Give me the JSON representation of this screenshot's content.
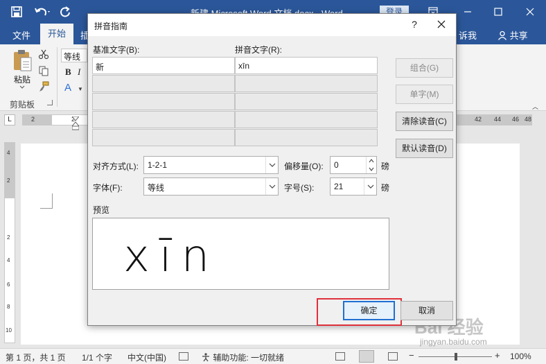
{
  "window": {
    "title": "新建 Microsoft Word 文档.docx  -  Word",
    "login_label": "登录"
  },
  "ribbon": {
    "tabs": {
      "file": "文件",
      "home": "开始",
      "insert": "插",
      "tell_me": "诉我"
    },
    "share_label": "共享",
    "clipboard": {
      "paste_label": "粘贴",
      "group_label": "剪贴板"
    },
    "font": {
      "name_value": "等线",
      "bold_label": "B",
      "italic_label": "I",
      "text_effects_label": "A"
    }
  },
  "ruler": {
    "corner_label": "L",
    "left_numbers": [
      "2",
      "2"
    ],
    "right_numbers": [
      "42",
      "44",
      "46",
      "48"
    ],
    "vertical_numbers": [
      "4",
      "2",
      "2",
      "4",
      "6",
      "8",
      "10"
    ]
  },
  "dialog": {
    "title": "拼音指南",
    "help_label": "?",
    "base_text_label": "基准文字(B):",
    "ruby_text_label": "拼音文字(R):",
    "rows": [
      {
        "base": "新",
        "ruby": "xīn"
      },
      {
        "base": "",
        "ruby": ""
      },
      {
        "base": "",
        "ruby": ""
      },
      {
        "base": "",
        "ruby": ""
      },
      {
        "base": "",
        "ruby": ""
      }
    ],
    "buttons": {
      "group": "组合(G)",
      "mono": "单字(M)",
      "clear": "清除读音(C)",
      "default": "默认读音(D)",
      "ok": "确定",
      "cancel": "取消"
    },
    "alignment": {
      "label": "对齐方式(L):",
      "value": "1-2-1"
    },
    "font": {
      "label": "字体(F):",
      "value": "等线"
    },
    "offset": {
      "label": "偏移量(O):",
      "value": "0",
      "unit": "磅"
    },
    "size": {
      "label": "字号(S):",
      "value": "21",
      "unit": "磅"
    },
    "preview_label": "预览",
    "preview_text": "xīn"
  },
  "status": {
    "page": "第 1 页，共 1 页",
    "words": "1/1 个字",
    "language": "中文(中国)",
    "accessibility": "辅助功能: 一切就绪",
    "zoom": "100%",
    "zoom_minus": "−",
    "zoom_plus": "+"
  },
  "watermark": {
    "text": "Bai 经验",
    "url": "jingyan.baidu.com"
  },
  "colors": {
    "title_blue": "#2b579a",
    "highlight_red": "#e0303a",
    "default_button_blue": "#1f6fd1"
  }
}
